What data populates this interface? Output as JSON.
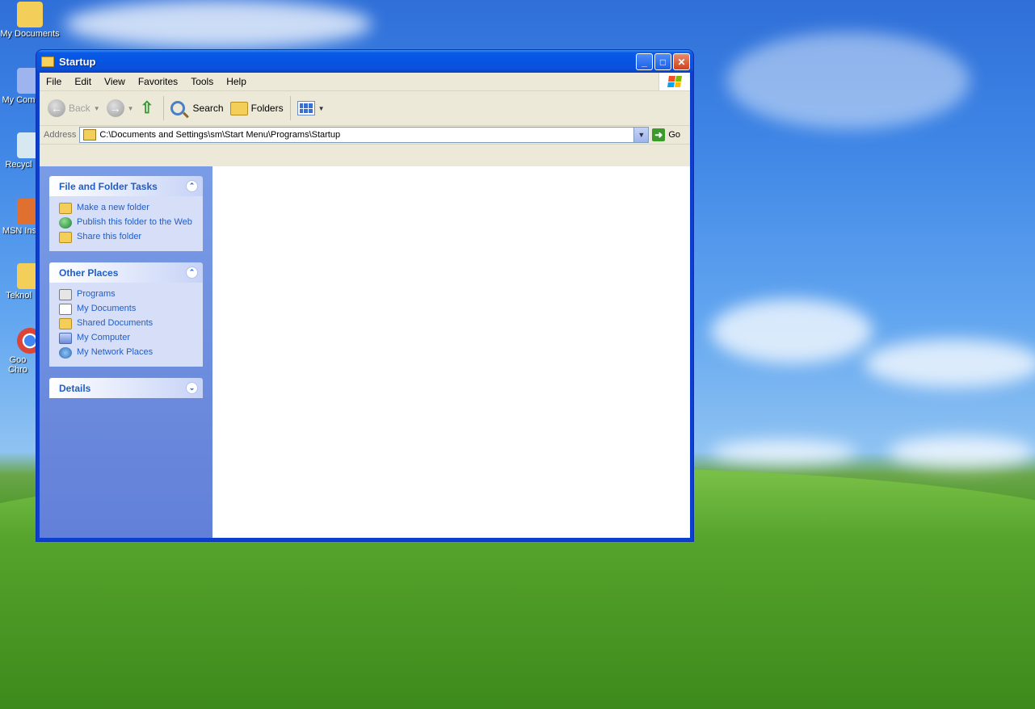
{
  "desktop": {
    "icons": [
      {
        "label": "My Documents"
      },
      {
        "label": "My Com"
      },
      {
        "label": "Recycl"
      },
      {
        "label": "MSN Ins"
      },
      {
        "label": "Teknol"
      },
      {
        "label": "Goo Chro"
      }
    ]
  },
  "window": {
    "title": "Startup",
    "controls": {
      "minimize": "_",
      "maximize": "□",
      "close": "✕"
    }
  },
  "menu": {
    "items": [
      "File",
      "Edit",
      "View",
      "Favorites",
      "Tools",
      "Help"
    ]
  },
  "toolbar": {
    "back_label": "Back",
    "search_label": "Search",
    "folders_label": "Folders"
  },
  "address": {
    "label": "Address",
    "value": "C:\\Documents and Settings\\sm\\Start Menu\\Programs\\Startup",
    "go_label": "Go"
  },
  "taskpane": {
    "file_tasks": {
      "title": "File and Folder Tasks",
      "items": [
        "Make a new folder",
        "Publish this folder to the Web",
        "Share this folder"
      ]
    },
    "other_places": {
      "title": "Other Places",
      "items": [
        "Programs",
        "My Documents",
        "Shared Documents",
        "My Computer",
        "My Network Places"
      ]
    },
    "details": {
      "title": "Details"
    }
  }
}
